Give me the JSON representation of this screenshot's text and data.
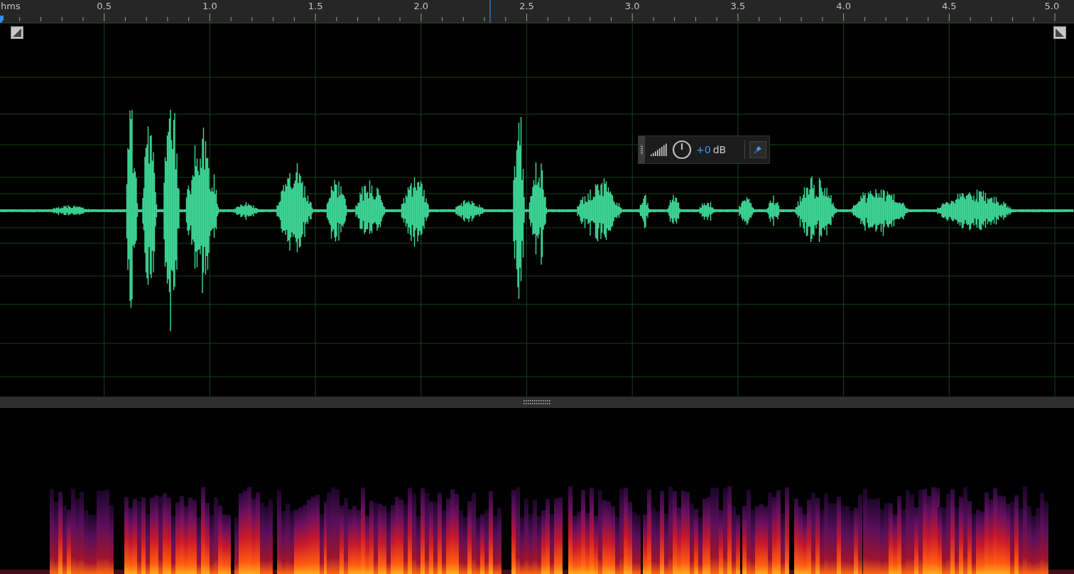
{
  "ruler": {
    "unit": "hms",
    "labels": [
      "0.5",
      "1.0",
      "1.5",
      "2.0",
      "2.5",
      "3.0",
      "3.5",
      "4.0",
      "4.5",
      "5.0"
    ]
  },
  "hud": {
    "gain_value": "+0",
    "gain_unit": "dB"
  }
}
